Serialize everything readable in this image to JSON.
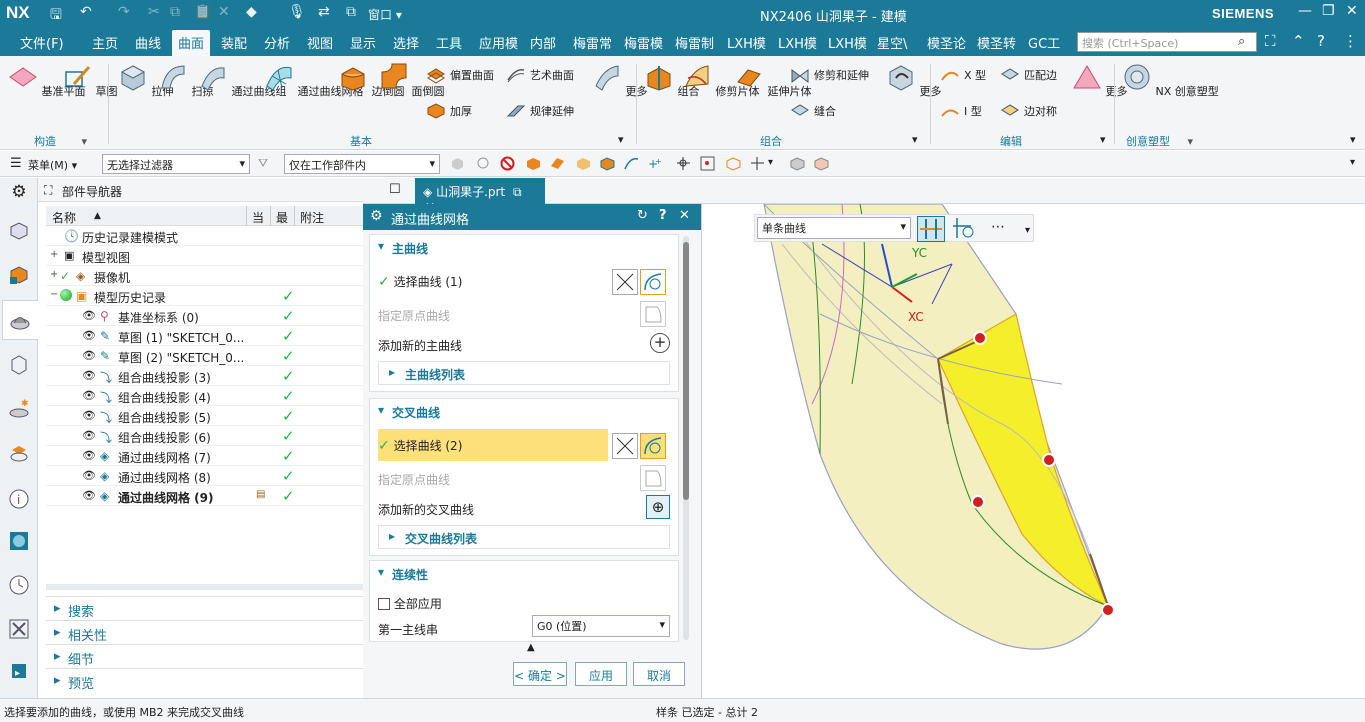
{
  "app": {
    "logo": "NX",
    "window_label": "窗口",
    "title": "NX2406 山洞果子 - 建模",
    "brand": "SIEMENS"
  },
  "menu": {
    "items": [
      "文件(F)",
      "主页",
      "曲线",
      "曲面",
      "装配",
      "分析",
      "视图",
      "显示",
      "选择",
      "工具",
      "应用模",
      "内部",
      "梅雷常",
      "梅雷模",
      "梅雷制",
      "LXH模",
      "LXH模",
      "LXH模",
      "星空\\",
      "模圣论",
      "模圣转",
      "GC工"
    ],
    "active": "曲面",
    "search_placeholder": "搜索 (Ctrl+Space)"
  },
  "ribbon": {
    "buttons": [
      "基准平面",
      "草图",
      "拉伸",
      "扫掠",
      "通过曲线组",
      "通过曲线网格",
      "边倒圆",
      "面倒圆",
      "偏置曲面",
      "加厚",
      "艺术曲面",
      "规律延伸",
      "更多",
      "组合",
      "修剪片体",
      "延伸片体",
      "修剪和延伸",
      "缝合",
      "更多",
      "X 型",
      "I 型",
      "匹配边",
      "边对称",
      "更多",
      "NX 创意塑型"
    ],
    "groups": [
      "构造",
      "基本",
      "组合",
      "编辑",
      "创意塑型"
    ]
  },
  "toolbar2": {
    "menu_label": "菜单(M)",
    "filter": "无选择过滤器",
    "scope": "仅在工作部件内"
  },
  "navigator": {
    "title": "部件导航器",
    "columns": [
      "名称",
      "当",
      "最",
      "附注"
    ],
    "rows": [
      {
        "label": "历史记录建模模式"
      },
      {
        "label": "模型视图"
      },
      {
        "label": "摄像机"
      },
      {
        "label": "模型历史记录"
      },
      {
        "label": "基准坐标系 (0)"
      },
      {
        "label": "草图 (1) \"SKETCH_0..."
      },
      {
        "label": "草图 (2) \"SKETCH_0..."
      },
      {
        "label": "组合曲线投影 (3)"
      },
      {
        "label": "组合曲线投影 (4)"
      },
      {
        "label": "组合曲线投影 (5)"
      },
      {
        "label": "组合曲线投影 (6)"
      },
      {
        "label": "通过曲线网格 (7)"
      },
      {
        "label": "通过曲线网格 (8)"
      },
      {
        "label": "通过曲线网格 (9)"
      }
    ],
    "panels": [
      "搜索",
      "相关性",
      "细节",
      "预览"
    ]
  },
  "tab": {
    "label": "山洞果子.prt"
  },
  "dialog": {
    "title": "通过曲线网格",
    "primary": {
      "header": "主曲线",
      "select": "选择曲线 (1)",
      "origin": "指定原点曲线",
      "add": "添加新的主曲线",
      "list": "主曲线列表"
    },
    "cross": {
      "header": "交叉曲线",
      "select": "选择曲线 (2)",
      "origin": "指定原点曲线",
      "add": "添加新的交叉曲线",
      "list": "交叉曲线列表"
    },
    "continuity": {
      "header": "连续性",
      "apply_all": "全部应用",
      "first_primary": "第一主线串",
      "g0": "G0 (位置)"
    },
    "ok": "< 确定 >",
    "apply": "应用",
    "cancel": "取消"
  },
  "viewport": {
    "curve_rule": "单条曲线",
    "yc": "YC",
    "xc": "XC"
  },
  "status": {
    "prompt": "选择要添加的曲线，或使用 MB2 来完成交叉曲线",
    "selection": "样条 已选定 - 总计 2"
  }
}
